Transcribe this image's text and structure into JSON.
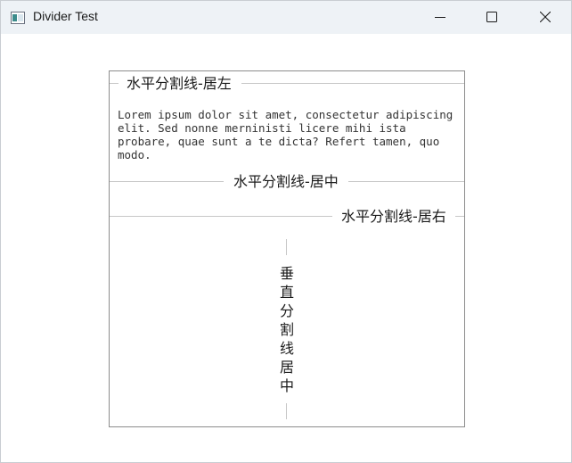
{
  "window": {
    "title": "Divider Test",
    "icon": "app-window-icon",
    "controls": {
      "minimize_icon": "minimize-icon",
      "maximize_icon": "maximize-icon",
      "close_icon": "close-icon"
    }
  },
  "content": {
    "divider_left_label": "水平分割线-居左",
    "paragraph": "Lorem ipsum dolor sit amet, consectetur adipiscing elit. Sed nonne merninisti licere mihi ista probare, quae sunt a te dicta? Refert tamen, quo modo.",
    "divider_center_label": "水平分割线-居中",
    "divider_right_label": "水平分割线-居右",
    "vertical_divider_label": "垂直分割线居中"
  },
  "colors": {
    "titlebar_bg": "#eef2f6",
    "divider_line": "#c8c8c8",
    "panel_border": "#8c8c8c"
  }
}
